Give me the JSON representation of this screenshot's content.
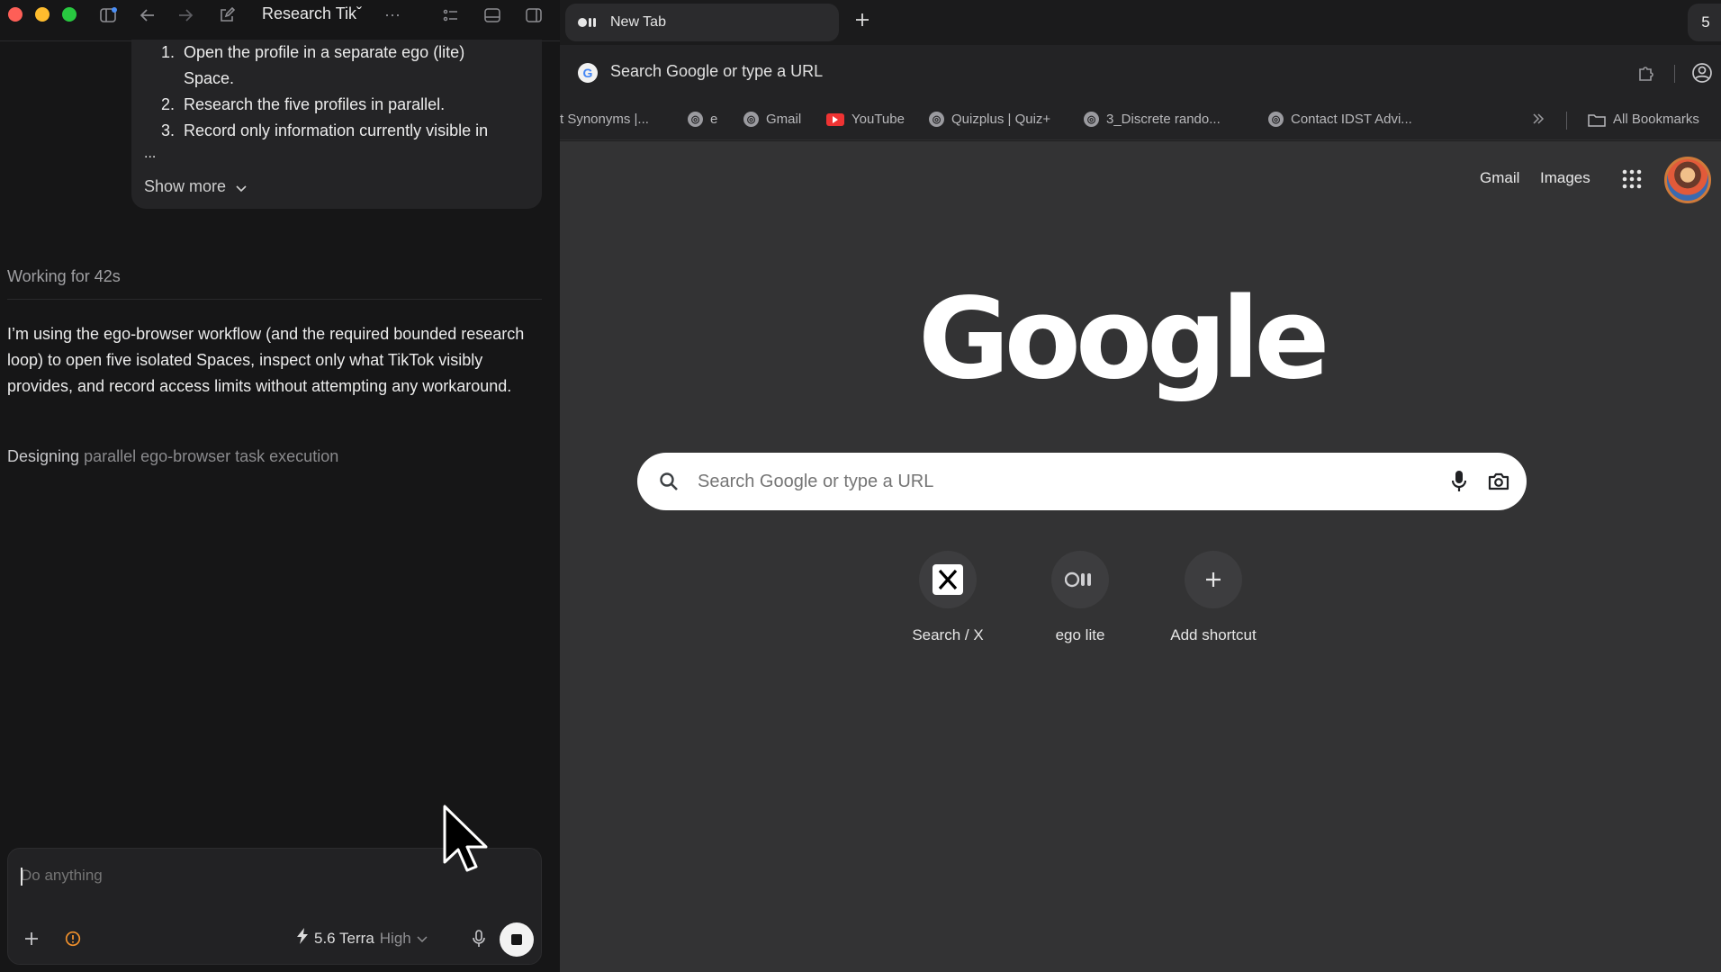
{
  "left": {
    "title": "Research Tikˇ",
    "plan_items": [
      {
        "num": "1.",
        "text": "Open the profile in a separate ego (lite)"
      },
      {
        "num": "",
        "text": "Space."
      },
      {
        "num": "2.",
        "text": "Research the five profiles in parallel."
      },
      {
        "num": "3.",
        "text": "Record only information currently visible in"
      }
    ],
    "ellipsis": "...",
    "show_more": "Show more",
    "working": "Working for 42s",
    "message": "I’m using the ego-browser workflow (and the required bounded research loop) to open five isolated Spaces, inspect only what TikTok visibly provides, and record access limits without attempting any workaround.",
    "status_strong": "Designing",
    "status_rest": " parallel ego-browser task execution",
    "composer_placeholder": "Do anything",
    "model": "5.6 Terra",
    "model_level": "High"
  },
  "browser": {
    "tab_title": "New Tab",
    "tab_count": "5",
    "omnibox": "Search Google or type a URL",
    "bookmarks": [
      "t Synonyms |...",
      "e",
      "Gmail",
      "YouTube",
      "Quizplus | Quiz+",
      "3_Discrete rando...",
      "Contact IDST Advi..."
    ],
    "all_bookmarks": "All Bookmarks",
    "ntp": {
      "gmail": "Gmail",
      "images": "Images",
      "logo": "Google",
      "search_placeholder": "Search Google or type a URL",
      "shortcuts": [
        "Search / X",
        "ego lite",
        "Add shortcut"
      ]
    }
  }
}
